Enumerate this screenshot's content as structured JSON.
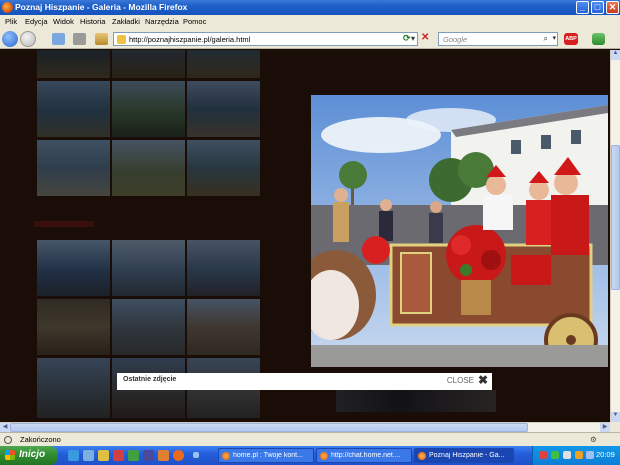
{
  "window": {
    "title": "Poznaj Hiszpanie - Galeria - Mozilla Firefox",
    "controls": {
      "minimize": "_",
      "maximize": "□",
      "close": "✕"
    }
  },
  "menu": [
    "Plik",
    "Edycja",
    "Widok",
    "Historia",
    "Zakładki",
    "Narzędzia",
    "Pomoc"
  ],
  "navbar": {
    "url": "http://poznajhiszpanie.pl/galeria.html",
    "search_engine": "Google",
    "search_placeholder": "Google",
    "abp_label": "ABP"
  },
  "lightbox": {
    "caption": "Ostatnie zdjęcie",
    "close_label": "CLOSE"
  },
  "status": {
    "text": "Zakończono"
  },
  "taskbar": {
    "start_label": "Inicjo",
    "tasks": [
      {
        "label": "home.pl : Twoje kont..."
      },
      {
        "label": "http://chat.home.net...."
      },
      {
        "label": "Poznaj Hiszpanie - Ga..."
      }
    ],
    "clock": "20:09"
  },
  "colors": {
    "page_background": "#1a0d08",
    "xp_blue": "#245edc",
    "start_green": "#2f8a2f"
  },
  "icons": [
    "firefox-icon",
    "back-icon",
    "forward-icon",
    "reload-icon",
    "stop-icon",
    "home-icon",
    "search-icon",
    "windows-flag-icon"
  ]
}
